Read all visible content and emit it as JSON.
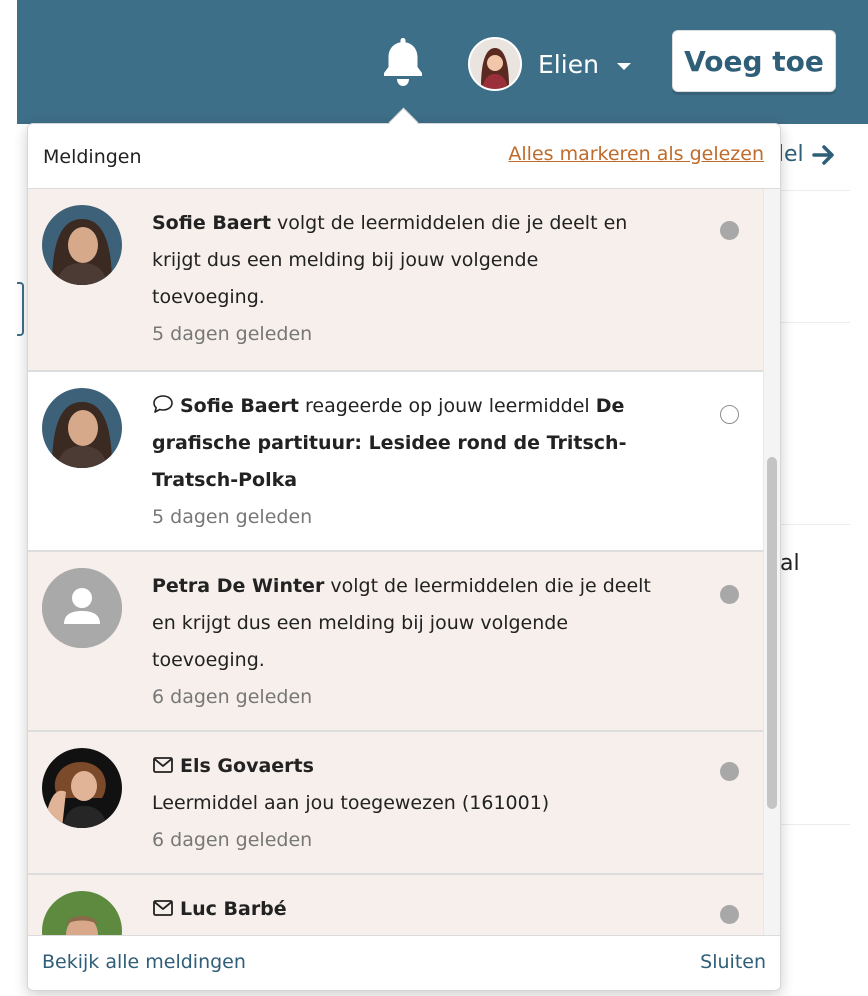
{
  "header": {
    "user_name": "Elien",
    "add_button": "Voeg toe",
    "colors": {
      "bar": "#3e6f88",
      "accent": "#2f5e79",
      "link_orange": "#c06b2b"
    }
  },
  "background": {
    "link_text": "del",
    "text_fragment": "al"
  },
  "panel": {
    "title": "Meldingen",
    "mark_all": "Alles markeren als gelezen",
    "items": [
      {
        "name": "Sofie Baert",
        "icon": "",
        "text": "volgt de leermiddelen die je deelt en krijgt dus een melding bij jouw volgende toevoeging.",
        "line1": "volgt de leermiddelen die je deelt en",
        "line2": "krijgt dus een melding bij jouw volgende",
        "line3": "toevoeging.",
        "time": "5 dagen geleden",
        "unread": true,
        "avatar": "photo-woman"
      },
      {
        "name": "Sofie Baert",
        "icon": "comment-icon",
        "verb": "reageerde op jouw leermiddel",
        "object_line1": "De",
        "object_line2": "grafische partituur: Lesidee rond de Tritsch-",
        "object_line3": "Tratsch-Polka",
        "time": "5 dagen geleden",
        "unread": false,
        "avatar": "photo-woman"
      },
      {
        "name": "Petra De Winter",
        "icon": "",
        "line1": "volgt de leermiddelen die je deelt",
        "line2": "en krijgt dus een melding bij jouw volgende",
        "line3": "toevoeging.",
        "time": "6 dagen geleden",
        "unread": true,
        "avatar": "default-user"
      },
      {
        "name": "Els Govaerts",
        "icon": "mail-icon",
        "line2": "Leermiddel aan jou toegewezen (161001)",
        "time": "6 dagen geleden",
        "unread": true,
        "avatar": "photo-woman-dark"
      },
      {
        "name": "Luc Barbé",
        "icon": "mail-icon",
        "unread": true,
        "avatar": "photo-man"
      }
    ],
    "footer_left": "Bekijk alle meldingen",
    "footer_right": "Sluiten"
  }
}
